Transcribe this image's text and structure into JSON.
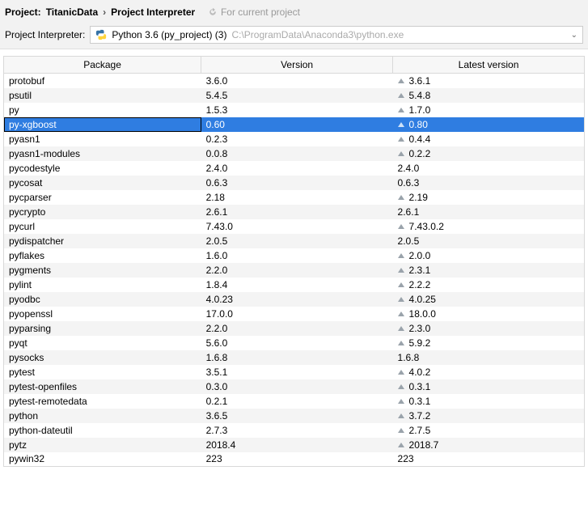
{
  "breadcrumb": {
    "project_label": "Project:",
    "project_name": "TitanicData",
    "section": "Project Interpreter",
    "current_project_note": "For current project"
  },
  "interpreter_selector": {
    "label": "Project Interpreter:",
    "selected_name": "Python 3.6 (py_project) (3)",
    "selected_path": "C:\\ProgramData\\Anaconda3\\python.exe"
  },
  "table": {
    "headers": {
      "package": "Package",
      "version": "Version",
      "latest": "Latest version"
    },
    "selected_index": 3,
    "rows": [
      {
        "package": "protobuf",
        "version": "3.6.0",
        "latest": "3.6.1",
        "upgrade": true
      },
      {
        "package": "psutil",
        "version": "5.4.5",
        "latest": "5.4.8",
        "upgrade": true
      },
      {
        "package": "py",
        "version": "1.5.3",
        "latest": "1.7.0",
        "upgrade": true
      },
      {
        "package": "py-xgboost",
        "version": "0.60",
        "latest": "0.80",
        "upgrade": true
      },
      {
        "package": "pyasn1",
        "version": "0.2.3",
        "latest": "0.4.4",
        "upgrade": true
      },
      {
        "package": "pyasn1-modules",
        "version": "0.0.8",
        "latest": "0.2.2",
        "upgrade": true
      },
      {
        "package": "pycodestyle",
        "version": "2.4.0",
        "latest": "2.4.0",
        "upgrade": false
      },
      {
        "package": "pycosat",
        "version": "0.6.3",
        "latest": "0.6.3",
        "upgrade": false
      },
      {
        "package": "pycparser",
        "version": "2.18",
        "latest": "2.19",
        "upgrade": true
      },
      {
        "package": "pycrypto",
        "version": "2.6.1",
        "latest": "2.6.1",
        "upgrade": false
      },
      {
        "package": "pycurl",
        "version": "7.43.0",
        "latest": "7.43.0.2",
        "upgrade": true
      },
      {
        "package": "pydispatcher",
        "version": "2.0.5",
        "latest": "2.0.5",
        "upgrade": false
      },
      {
        "package": "pyflakes",
        "version": "1.6.0",
        "latest": "2.0.0",
        "upgrade": true
      },
      {
        "package": "pygments",
        "version": "2.2.0",
        "latest": "2.3.1",
        "upgrade": true
      },
      {
        "package": "pylint",
        "version": "1.8.4",
        "latest": "2.2.2",
        "upgrade": true
      },
      {
        "package": "pyodbc",
        "version": "4.0.23",
        "latest": "4.0.25",
        "upgrade": true
      },
      {
        "package": "pyopenssl",
        "version": "17.0.0",
        "latest": "18.0.0",
        "upgrade": true
      },
      {
        "package": "pyparsing",
        "version": "2.2.0",
        "latest": "2.3.0",
        "upgrade": true
      },
      {
        "package": "pyqt",
        "version": "5.6.0",
        "latest": "5.9.2",
        "upgrade": true
      },
      {
        "package": "pysocks",
        "version": "1.6.8",
        "latest": "1.6.8",
        "upgrade": false
      },
      {
        "package": "pytest",
        "version": "3.5.1",
        "latest": "4.0.2",
        "upgrade": true
      },
      {
        "package": "pytest-openfiles",
        "version": "0.3.0",
        "latest": "0.3.1",
        "upgrade": true
      },
      {
        "package": "pytest-remotedata",
        "version": "0.2.1",
        "latest": "0.3.1",
        "upgrade": true
      },
      {
        "package": "python",
        "version": "3.6.5",
        "latest": "3.7.2",
        "upgrade": true
      },
      {
        "package": "python-dateutil",
        "version": "2.7.3",
        "latest": "2.7.5",
        "upgrade": true
      },
      {
        "package": "pytz",
        "version": "2018.4",
        "latest": "2018.7",
        "upgrade": true
      },
      {
        "package": "pywin32",
        "version": "223",
        "latest": "223",
        "upgrade": false
      }
    ]
  }
}
